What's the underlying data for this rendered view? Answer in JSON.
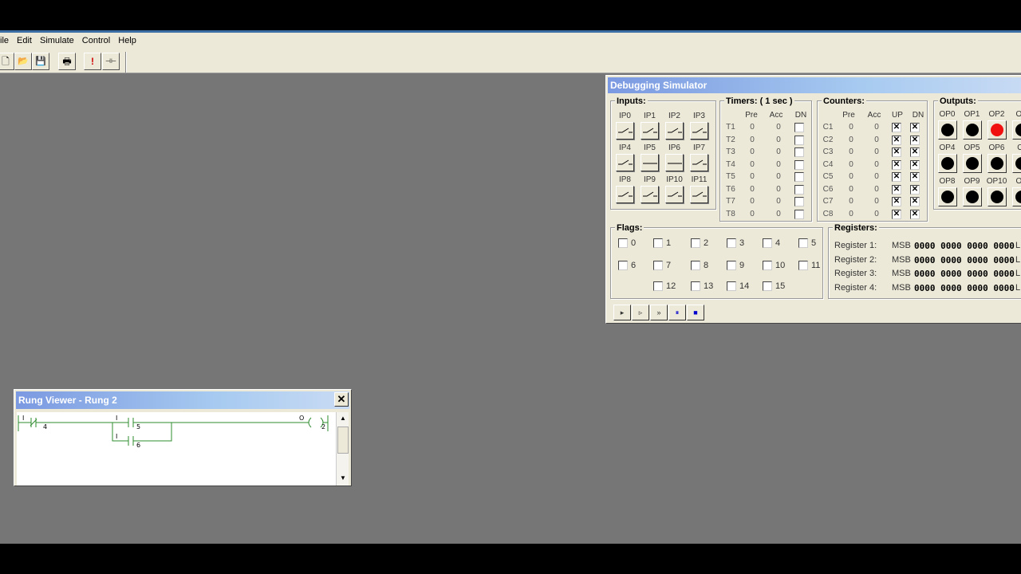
{
  "menu": [
    "ile",
    "Edit",
    "Simulate",
    "Control",
    "Help"
  ],
  "toolbar": {
    "buttons": [
      {
        "name": "new-file",
        "glyph": "🗋"
      },
      {
        "name": "open-file",
        "glyph": "📂"
      },
      {
        "name": "save-file",
        "glyph": "💾"
      },
      {
        "name": "print",
        "glyph": "🖶"
      },
      {
        "name": "alert",
        "glyph": "!"
      },
      {
        "name": "ladder",
        "glyph": "⊣⊢"
      }
    ]
  },
  "simulator": {
    "title": "Debugging Simulator",
    "inputs": {
      "title": "Inputs:",
      "labels": [
        "IP0",
        "IP1",
        "IP2",
        "IP3",
        "IP4",
        "IP5",
        "IP6",
        "IP7",
        "IP8",
        "IP9",
        "IP10",
        "IP11"
      ],
      "closed": [
        false,
        false,
        false,
        false,
        false,
        true,
        true,
        false,
        false,
        false,
        false,
        false
      ]
    },
    "timers": {
      "title": "Timers: ( 1 sec )",
      "headers": [
        "Pre",
        "Acc",
        "DN"
      ],
      "rows": [
        {
          "name": "T1",
          "pre": "0",
          "acc": "0"
        },
        {
          "name": "T2",
          "pre": "0",
          "acc": "0"
        },
        {
          "name": "T3",
          "pre": "0",
          "acc": "0"
        },
        {
          "name": "T4",
          "pre": "0",
          "acc": "0"
        },
        {
          "name": "T5",
          "pre": "0",
          "acc": "0"
        },
        {
          "name": "T6",
          "pre": "0",
          "acc": "0"
        },
        {
          "name": "T7",
          "pre": "0",
          "acc": "0"
        },
        {
          "name": "T8",
          "pre": "0",
          "acc": "0"
        }
      ]
    },
    "counters": {
      "title": "Counters:",
      "headers": [
        "Pre",
        "Acc",
        "UP",
        "DN"
      ],
      "rows": [
        {
          "name": "C1",
          "pre": "0",
          "acc": "0"
        },
        {
          "name": "C2",
          "pre": "0",
          "acc": "0"
        },
        {
          "name": "C3",
          "pre": "0",
          "acc": "0"
        },
        {
          "name": "C4",
          "pre": "0",
          "acc": "0"
        },
        {
          "name": "C5",
          "pre": "0",
          "acc": "0"
        },
        {
          "name": "C6",
          "pre": "0",
          "acc": "0"
        },
        {
          "name": "C7",
          "pre": "0",
          "acc": "0"
        },
        {
          "name": "C8",
          "pre": "0",
          "acc": "0"
        }
      ],
      "check_glyph": "✕"
    },
    "outputs": {
      "title": "Outputs:",
      "labels": [
        "OP0",
        "OP1",
        "OP2",
        "OF",
        "OP4",
        "OP5",
        "OP6",
        "OI",
        "OP8",
        "OP9",
        "OP10",
        "OF"
      ],
      "on": [
        false,
        false,
        true,
        false,
        false,
        false,
        false,
        false,
        false,
        false,
        false,
        false
      ]
    },
    "flags": {
      "title": "Flags:",
      "labels": [
        "0",
        "1",
        "2",
        "3",
        "4",
        "5",
        "6",
        "7",
        "8",
        "9",
        "10",
        "11",
        "12",
        "13",
        "14",
        "15"
      ]
    },
    "registers": {
      "title": "Registers:",
      "rows": [
        {
          "label": "Register 1:",
          "msb": "MSB",
          "value": "0000 0000 0000 0000",
          "lsb": "L"
        },
        {
          "label": "Register 2:",
          "msb": "MSB",
          "value": "0000 0000 0000 0000",
          "lsb": "L"
        },
        {
          "label": "Register 3:",
          "msb": "MSB",
          "value": "0000 0000 0000 0000",
          "lsb": "L"
        },
        {
          "label": "Register 4:",
          "msb": "MSB",
          "value": "0000 0000 0000 0000",
          "lsb": "L"
        }
      ]
    },
    "controls": [
      {
        "name": "run",
        "glyph": "▸"
      },
      {
        "name": "step",
        "glyph": "▹"
      },
      {
        "name": "fast-forward",
        "glyph": "»"
      },
      {
        "name": "pause",
        "glyph": "⏸"
      },
      {
        "name": "stop",
        "glyph": "■"
      }
    ]
  },
  "rung_viewer": {
    "title": "Rung Viewer - Rung 2",
    "close_glyph": "✕",
    "contacts": [
      {
        "top": "I",
        "bottom": "4"
      },
      {
        "top": "I",
        "bottom": "5"
      },
      {
        "top": "I",
        "bottom": "6"
      }
    ],
    "coil": {
      "top": "O",
      "bottom": "2"
    },
    "colors": {
      "ladder": "#2e8b2e"
    }
  }
}
